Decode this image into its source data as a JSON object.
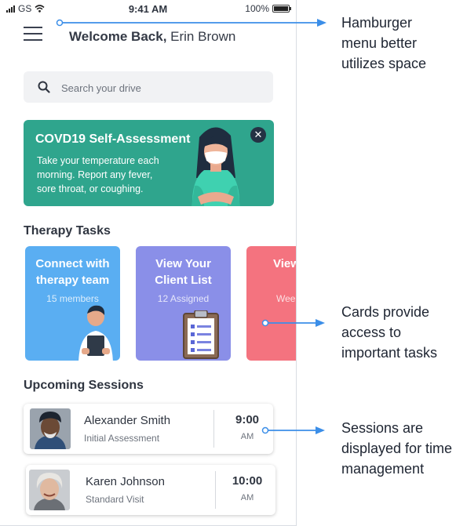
{
  "status_bar": {
    "carrier": "GS",
    "time": "9:41 AM",
    "battery": "100%"
  },
  "header": {
    "greeting": "Welcome Back,",
    "user_name": "Erin Brown"
  },
  "search": {
    "placeholder": "Search your drive"
  },
  "covid_banner": {
    "title": "COVD19 Self-Assessment",
    "body": "Take your temperature each\nmorning. Report any fever,\nsore throat,  or coughing.",
    "close_glyph": "✕"
  },
  "therapy_tasks": {
    "title": "Therapy Tasks",
    "cards": [
      {
        "title": "Connect with therapy team",
        "subtitle": "15 members",
        "color": "#5aaef2"
      },
      {
        "title": "View Your Client List",
        "subtitle": "12 Assigned",
        "color": "#8a8fe8"
      },
      {
        "title": "View Prod",
        "subtitle": "Wee",
        "color": "#f4737f"
      }
    ]
  },
  "upcoming_sessions": {
    "title": "Upcoming Sessions",
    "items": [
      {
        "name": "Alexander Smith",
        "type": "Initial Assessment",
        "time": "9:00",
        "ampm": "AM"
      },
      {
        "name": "Karen Johnson",
        "type": "Standard Visit",
        "time": "10:00",
        "ampm": "AM"
      }
    ]
  },
  "annotations": {
    "hamburger": "Hamburger\nmenu better\nutilizes space",
    "cards": "Cards provide\naccess to\nimportant  tasks",
    "sessions": "Sessions are\ndisplayed for time\nmanagement",
    "arrow_color": "#3b8ee8"
  }
}
